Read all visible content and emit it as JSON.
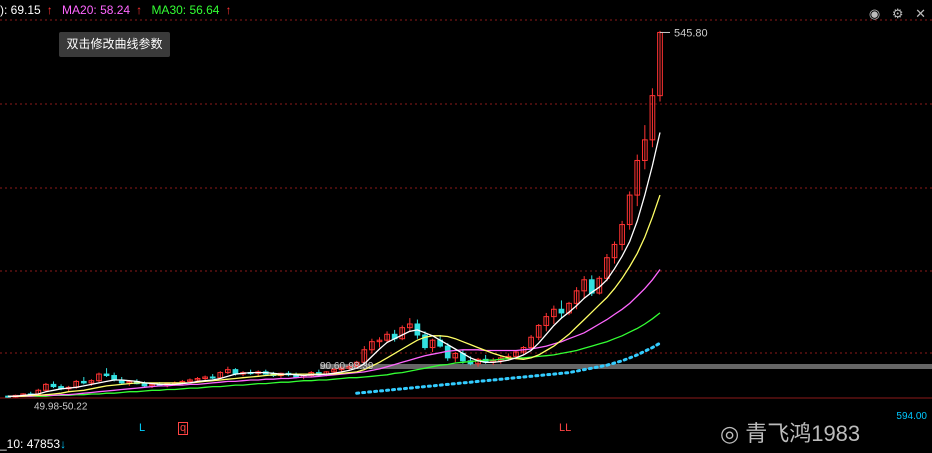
{
  "header": {
    "ma10": "): 69.15",
    "ma20": "MA20: 58.24",
    "ma30": "MA30: 56.64",
    "arrow": "↑"
  },
  "tooltip": "双击修改曲线参数",
  "icons": [
    "eye-icon",
    "gear-icon",
    "close-icon"
  ],
  "volume": {
    "label": "_10: 47853",
    "arrow": "↓"
  },
  "right_volume": "594.00",
  "markers": [
    {
      "text": "L",
      "style": "cyan"
    },
    {
      "text": "q",
      "style": "box"
    },
    {
      "text": "LL",
      "style": "red"
    }
  ],
  "watermark": "青飞鸿1983",
  "chart_data": {
    "type": "candlestick",
    "annotations": [
      {
        "text": "545.80",
        "value": 545.8
      },
      {
        "text": "90.60-98.39",
        "value": 94.5
      },
      {
        "text": "49.98-50.22",
        "value": 50.1
      }
    ],
    "ylim": [
      40,
      560
    ],
    "colors": {
      "up": "#ff3333",
      "down": "#33e0e0",
      "ma5": "#ffffff",
      "ma10": "#ffff66",
      "ma20": "#ff66ff",
      "ma30": "#33ff33",
      "ma60": "#33ccff"
    },
    "candles": [
      [
        52,
        53,
        50,
        51
      ],
      [
        51,
        54,
        50,
        53
      ],
      [
        53,
        56,
        52,
        55
      ],
      [
        55,
        58,
        53,
        54
      ],
      [
        54,
        62,
        53,
        60
      ],
      [
        60,
        70,
        58,
        68
      ],
      [
        68,
        72,
        63,
        65
      ],
      [
        65,
        68,
        60,
        62
      ],
      [
        62,
        66,
        58,
        64
      ],
      [
        64,
        74,
        62,
        72
      ],
      [
        72,
        78,
        68,
        70
      ],
      [
        70,
        75,
        66,
        73
      ],
      [
        73,
        84,
        71,
        82
      ],
      [
        82,
        90,
        78,
        80
      ],
      [
        80,
        84,
        72,
        74
      ],
      [
        74,
        78,
        68,
        70
      ],
      [
        70,
        74,
        66,
        72
      ],
      [
        72,
        75,
        68,
        69
      ],
      [
        69,
        72,
        64,
        66
      ],
      [
        66,
        70,
        63,
        68
      ],
      [
        68,
        71,
        65,
        67
      ],
      [
        67,
        70,
        64,
        69
      ],
      [
        69,
        72,
        66,
        70
      ],
      [
        70,
        74,
        68,
        72
      ],
      [
        72,
        76,
        70,
        74
      ],
      [
        74,
        78,
        72,
        76
      ],
      [
        76,
        80,
        73,
        78
      ],
      [
        78,
        82,
        75,
        77
      ],
      [
        77,
        86,
        76,
        84
      ],
      [
        84,
        92,
        82,
        88
      ],
      [
        88,
        90,
        80,
        82
      ],
      [
        82,
        86,
        79,
        84
      ],
      [
        84,
        88,
        81,
        83
      ],
      [
        83,
        87,
        80,
        85
      ],
      [
        85,
        88,
        81,
        82
      ],
      [
        82,
        85,
        78,
        80
      ],
      [
        80,
        84,
        77,
        83
      ],
      [
        83,
        86,
        79,
        81
      ],
      [
        81,
        84,
        76,
        78
      ],
      [
        78,
        82,
        75,
        80
      ],
      [
        80,
        86,
        78,
        84
      ],
      [
        84,
        88,
        80,
        82
      ],
      [
        82,
        86,
        79,
        85
      ],
      [
        85,
        90,
        83,
        88
      ],
      [
        88,
        92,
        85,
        90
      ],
      [
        90,
        96,
        86,
        92
      ],
      [
        92,
        100,
        90,
        98
      ],
      [
        98,
        120,
        96,
        115
      ],
      [
        115,
        130,
        110,
        126
      ],
      [
        126,
        132,
        118,
        128
      ],
      [
        128,
        140,
        124,
        136
      ],
      [
        136,
        142,
        126,
        130
      ],
      [
        130,
        148,
        128,
        145
      ],
      [
        145,
        158,
        140,
        150
      ],
      [
        150,
        156,
        130,
        135
      ],
      [
        135,
        140,
        115,
        118
      ],
      [
        118,
        130,
        112,
        128
      ],
      [
        128,
        135,
        118,
        120
      ],
      [
        120,
        124,
        100,
        104
      ],
      [
        104,
        112,
        98,
        110
      ],
      [
        110,
        115,
        96,
        100
      ],
      [
        100,
        106,
        94,
        96
      ],
      [
        96,
        104,
        92,
        102
      ],
      [
        102,
        108,
        96,
        98
      ],
      [
        98,
        104,
        94,
        100
      ],
      [
        100,
        106,
        96,
        104
      ],
      [
        104,
        110,
        100,
        106
      ],
      [
        106,
        114,
        102,
        112
      ],
      [
        112,
        120,
        108,
        118
      ],
      [
        118,
        135,
        115,
        132
      ],
      [
        132,
        150,
        128,
        148
      ],
      [
        148,
        165,
        140,
        160
      ],
      [
        160,
        175,
        150,
        170
      ],
      [
        170,
        182,
        158,
        165
      ],
      [
        165,
        180,
        162,
        178
      ],
      [
        178,
        200,
        170,
        195
      ],
      [
        195,
        215,
        185,
        210
      ],
      [
        210,
        216,
        188,
        192
      ],
      [
        192,
        215,
        190,
        212
      ],
      [
        212,
        245,
        208,
        240
      ],
      [
        240,
        262,
        232,
        258
      ],
      [
        258,
        290,
        250,
        285
      ],
      [
        285,
        330,
        278,
        325
      ],
      [
        325,
        380,
        310,
        372
      ],
      [
        372,
        420,
        360,
        400
      ],
      [
        400,
        470,
        390,
        460
      ],
      [
        460,
        548,
        452,
        545.8
      ]
    ],
    "ma5": [
      52,
      52,
      53,
      54,
      55,
      58,
      60,
      62,
      63,
      64,
      66,
      68,
      70,
      72,
      74,
      74,
      73,
      72,
      70,
      69,
      68,
      68,
      68,
      69,
      70,
      72,
      73,
      74,
      76,
      79,
      82,
      83,
      84,
      84,
      84,
      83,
      82,
      82,
      81,
      80,
      81,
      81,
      82,
      83,
      85,
      87,
      90,
      96,
      106,
      116,
      125,
      130,
      135,
      140,
      142,
      138,
      134,
      128,
      122,
      116,
      110,
      104,
      100,
      98,
      98,
      99,
      101,
      104,
      108,
      114,
      124,
      136,
      148,
      158,
      166,
      175,
      185,
      193,
      200,
      210,
      225,
      242,
      262,
      290,
      325,
      365,
      410
    ],
    "ma10": [
      52,
      52,
      52,
      53,
      53,
      54,
      55,
      56,
      58,
      59,
      60,
      62,
      64,
      66,
      67,
      68,
      69,
      70,
      70,
      70,
      70,
      70,
      70,
      70,
      70,
      71,
      72,
      73,
      74,
      75,
      76,
      77,
      78,
      79,
      80,
      81,
      81,
      82,
      82,
      82,
      82,
      82,
      82,
      82,
      83,
      84,
      85,
      88,
      93,
      98,
      104,
      110,
      116,
      122,
      128,
      132,
      134,
      134,
      133,
      130,
      126,
      122,
      118,
      114,
      110,
      107,
      104,
      103,
      102,
      104,
      108,
      114,
      120,
      128,
      136,
      146,
      156,
      166,
      176,
      186,
      198,
      212,
      228,
      246,
      268,
      295,
      325
    ],
    "ma20": [
      52,
      52,
      52,
      52,
      53,
      53,
      53,
      54,
      54,
      55,
      56,
      57,
      58,
      59,
      60,
      61,
      62,
      63,
      64,
      65,
      66,
      66,
      67,
      67,
      68,
      68,
      69,
      70,
      71,
      72,
      72,
      73,
      74,
      74,
      75,
      75,
      76,
      76,
      77,
      78,
      78,
      79,
      80,
      81,
      82,
      83,
      84,
      85,
      87,
      89,
      92,
      95,
      98,
      101,
      104,
      107,
      109,
      111,
      113,
      114,
      115,
      115,
      115,
      114,
      114,
      114,
      114,
      114,
      115,
      116,
      118,
      120,
      123,
      126,
      130,
      134,
      138,
      144,
      150,
      156,
      163,
      170,
      178,
      188,
      198,
      210,
      224
    ],
    "ma30": [
      52,
      52,
      52,
      52,
      52,
      52,
      53,
      53,
      53,
      54,
      54,
      55,
      55,
      56,
      56,
      57,
      58,
      58,
      59,
      60,
      60,
      61,
      61,
      62,
      63,
      63,
      64,
      65,
      65,
      66,
      67,
      67,
      68,
      69,
      69,
      70,
      71,
      71,
      72,
      73,
      73,
      74,
      74,
      75,
      76,
      77,
      77,
      78,
      79,
      80,
      81,
      83,
      84,
      86,
      88,
      90,
      92,
      94,
      95,
      97,
      98,
      99,
      100,
      101,
      101,
      102,
      103,
      104,
      104,
      105,
      106,
      107,
      108,
      110,
      112,
      114,
      117,
      120,
      123,
      126,
      130,
      134,
      139,
      144,
      150,
      157,
      165
    ],
    "ma60": [
      null,
      null,
      null,
      null,
      null,
      null,
      null,
      null,
      null,
      null,
      null,
      null,
      null,
      null,
      null,
      null,
      null,
      null,
      null,
      null,
      null,
      null,
      null,
      null,
      null,
      null,
      null,
      null,
      null,
      null,
      null,
      null,
      null,
      null,
      null,
      null,
      null,
      null,
      null,
      null,
      null,
      null,
      null,
      null,
      null,
      null,
      56,
      57,
      58,
      59,
      60,
      61,
      62,
      63,
      64,
      65,
      66,
      67,
      68,
      69,
      70,
      71,
      72,
      73,
      74,
      75,
      76,
      77,
      78,
      79,
      80,
      81,
      82,
      83,
      84,
      86,
      88,
      90,
      92,
      94,
      97,
      100,
      104,
      108,
      113,
      118,
      124
    ]
  }
}
